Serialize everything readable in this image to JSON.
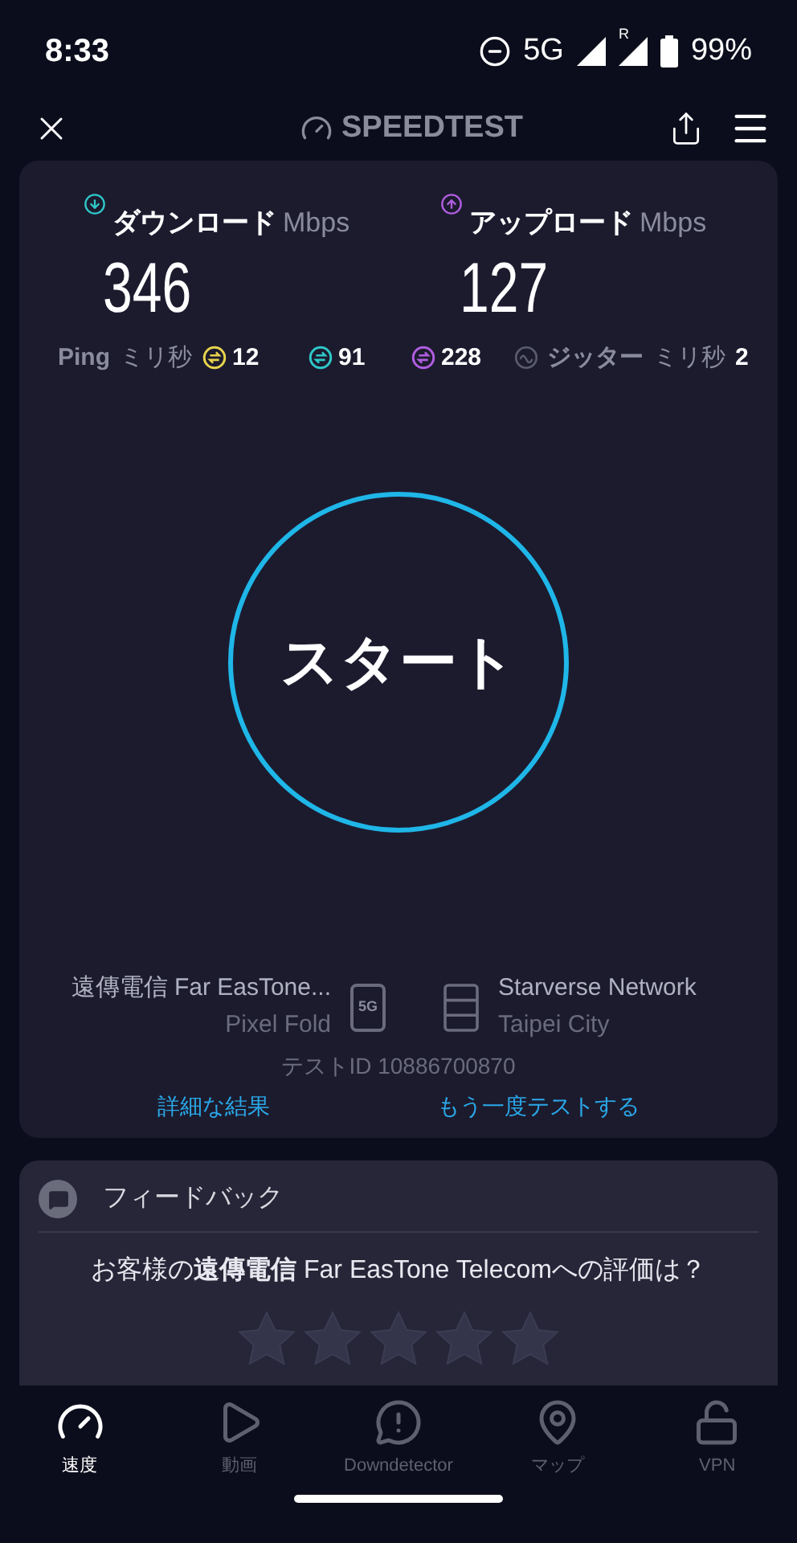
{
  "status_bar": {
    "time": "8:33",
    "network": "5G",
    "roaming": "R",
    "battery": "99%"
  },
  "header": {
    "title": "SPEEDTEST"
  },
  "results": {
    "download": {
      "label": "ダウンロード",
      "unit": "Mbps",
      "value": "346"
    },
    "upload": {
      "label": "アップロード",
      "unit": "Mbps",
      "value": "127"
    },
    "ping_label": "Ping",
    "ping_unit": "ミリ秒",
    "pings": [
      {
        "value": "12",
        "color": "#e8d44d"
      },
      {
        "value": "91",
        "color": "#2ec8c8"
      },
      {
        "value": "228",
        "color": "#b05ee0"
      }
    ],
    "jitter": {
      "label": "ジッター",
      "unit": "ミリ秒",
      "value": "2"
    }
  },
  "start_button": "スタート",
  "provider": {
    "name": "遠傳電信 Far EasTone...",
    "device": "Pixel Fold",
    "badge": "5G"
  },
  "server": {
    "name": "Starverse Network",
    "city": "Taipei City"
  },
  "test_id": "テストID 10886700870",
  "links": [
    "詳細な結果",
    "もう一度テストする"
  ],
  "feedback": {
    "title": "フィードバック",
    "question": "お客様の**遠傳電信** Far EasTone Telecomへの評価は？",
    "stars": 0
  },
  "nav": [
    {
      "label": "速度",
      "selected": true
    },
    {
      "label": "動画",
      "selected": false
    },
    {
      "label": "Downdetector",
      "selected": false
    },
    {
      "label": "マップ",
      "selected": false
    },
    {
      "label": "VPN",
      "selected": false
    }
  ]
}
